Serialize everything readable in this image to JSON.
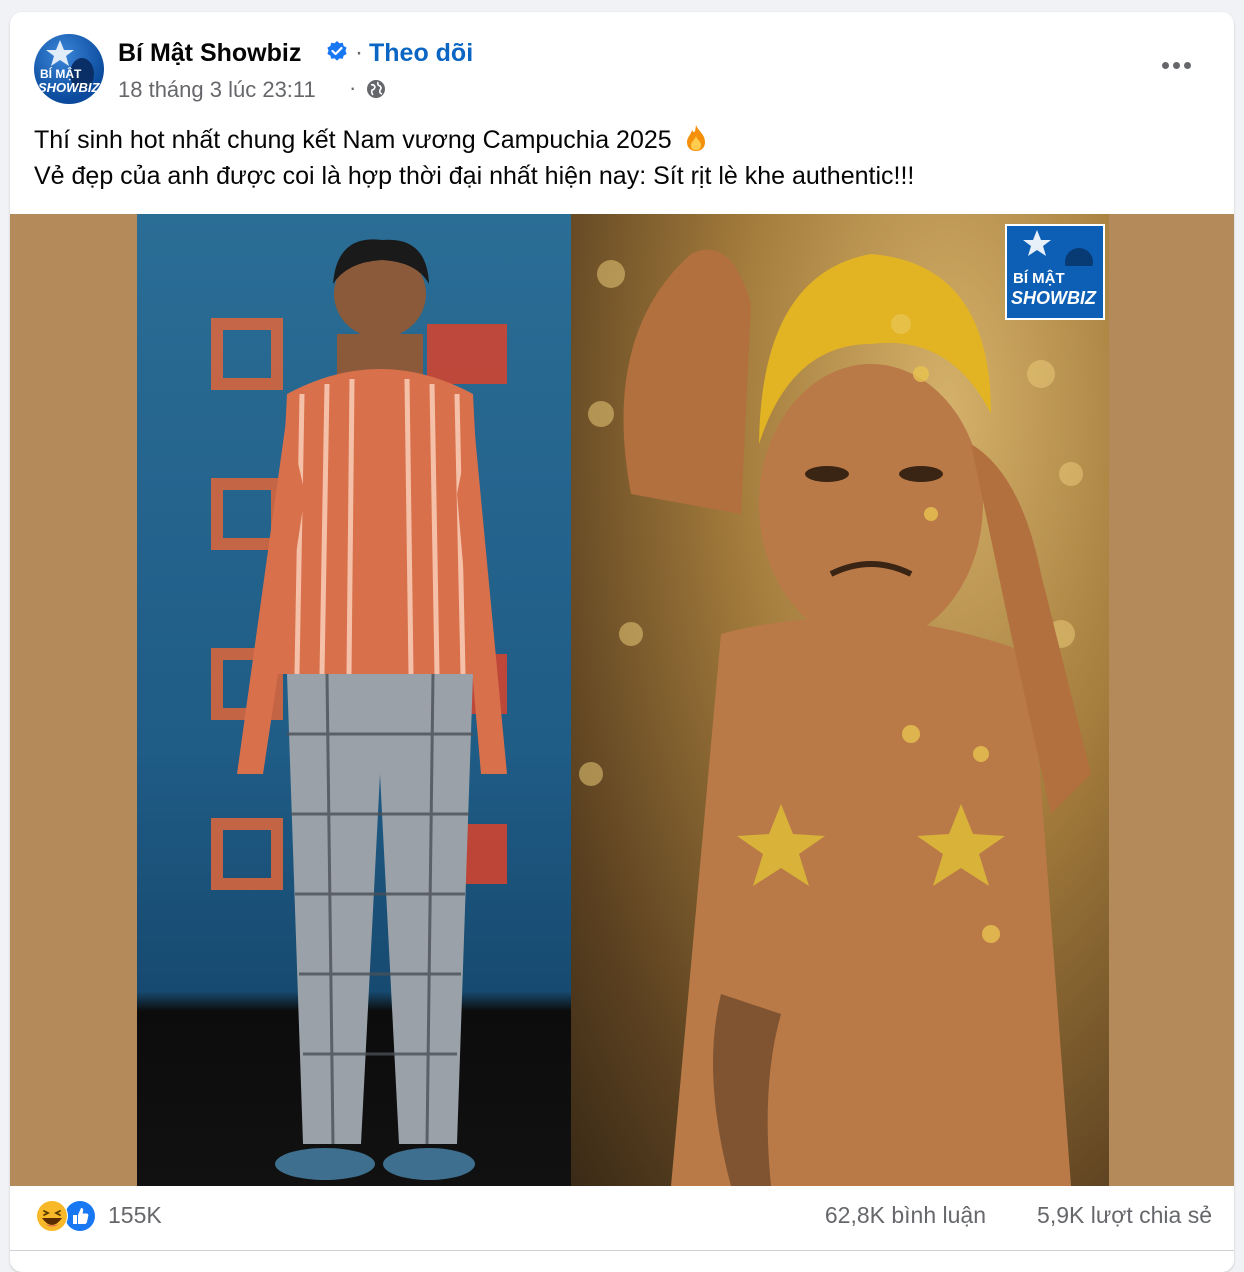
{
  "post": {
    "page_name": "Bí Mật Showbiz",
    "follow_label": "Theo dõi",
    "separator": "·",
    "timestamp": "18 tháng 3 lúc 23:11",
    "audience_icon": "globe-icon",
    "avatar_text_1": "BÍ MẬT",
    "avatar_text_2": "SHOWBIZ",
    "caption_line_1": "Thí sinh hot nhất chung kết Nam vương Campuchia 2025",
    "caption_line_2": "Vẻ đẹp của anh được coi là hợp thời đại nhất hiện nay: Sít rịt lè khe authentic!!!"
  },
  "media": {
    "background_color": "#b58a5a",
    "watermark_text_1": "BÍ MẬT",
    "watermark_text_2": "SHOWBIZ"
  },
  "footer": {
    "reaction_count": "155K",
    "comment_count": "62,8K bình luận",
    "share_count": "5,9K lượt chia sẻ"
  },
  "colors": {
    "link": "#0a66c2",
    "verified": "#1877f2",
    "secondary_text": "#65676b"
  }
}
